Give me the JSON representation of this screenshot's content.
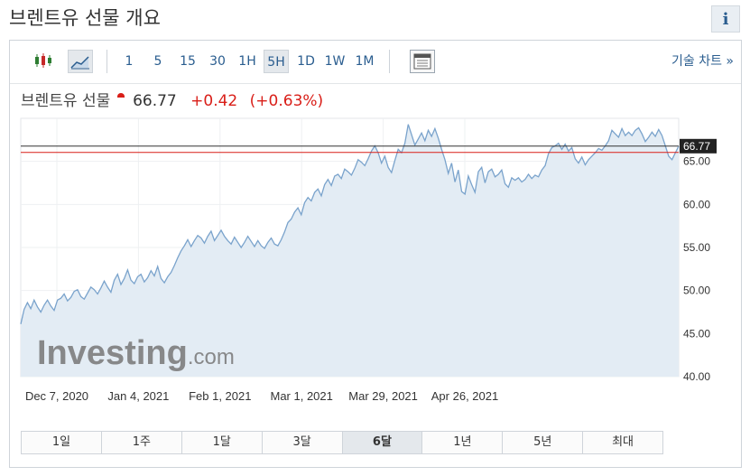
{
  "page": {
    "title": "브렌트유 선물 개요",
    "info_icon": "i"
  },
  "toolbar": {
    "chart_types": [
      {
        "name": "candlestick-chart-icon",
        "selected": false
      },
      {
        "name": "area-chart-icon",
        "selected": true
      }
    ],
    "intervals": [
      {
        "label": "1",
        "selected": false
      },
      {
        "label": "5",
        "selected": false
      },
      {
        "label": "15",
        "selected": false
      },
      {
        "label": "30",
        "selected": false
      },
      {
        "label": "1H",
        "selected": false
      },
      {
        "label": "5H",
        "selected": true
      },
      {
        "label": "1D",
        "selected": false
      },
      {
        "label": "1W",
        "selected": false
      },
      {
        "label": "1M",
        "selected": false
      }
    ],
    "table_icon": "table-view-icon",
    "tech_chart_link": "기술 차트 »"
  },
  "quote": {
    "name": "브렌트유 선물",
    "price": "66.77",
    "change": "+0.42",
    "change_pct": "(+0.63%)",
    "change_color": "#d91e18"
  },
  "chart_data": {
    "type": "area",
    "title": "",
    "xlabel": "",
    "ylabel": "",
    "ylim": [
      40,
      70
    ],
    "yticks": [
      "40.00",
      "45.00",
      "50.00",
      "55.00",
      "60.00",
      "65.00"
    ],
    "x_tick_labels": [
      "Dec 7, 2020",
      "Jan 4, 2021",
      "Feb 1, 2021",
      "Mar 1, 2021",
      "Mar 29, 2021",
      "Apr 26, 2021"
    ],
    "current_label": "66.77",
    "current_value": 66.77,
    "reference_value": 66.35,
    "line_color": "#7aa3cc",
    "fill_color": "#e3ecf4",
    "watermark": "Investing.com",
    "series": [
      {
        "values": [
          46.1,
          47.8,
          48.6,
          47.9,
          48.9,
          48.1,
          47.5,
          48.3,
          48.9,
          48.2,
          47.7,
          48.9,
          49.1,
          49.6,
          48.8,
          49.2,
          49.9,
          50.1,
          49.3,
          49.0,
          49.7,
          50.4,
          50.1,
          49.6,
          50.3,
          51.1,
          50.4,
          49.8,
          51.2,
          51.9,
          50.7,
          51.4,
          52.4,
          51.2,
          50.8,
          51.6,
          51.9,
          51.0,
          51.5,
          52.3,
          51.7,
          52.8,
          51.4,
          50.9,
          51.6,
          52.1,
          52.9,
          53.8,
          54.6,
          55.2,
          55.9,
          55.1,
          55.8,
          56.4,
          56.1,
          55.5,
          56.3,
          56.9,
          55.8,
          56.4,
          57.0,
          56.3,
          55.8,
          55.4,
          56.2,
          55.6,
          55.0,
          55.6,
          56.3,
          55.7,
          55.1,
          55.8,
          55.2,
          54.9,
          55.6,
          56.1,
          55.4,
          55.2,
          55.9,
          56.8,
          57.9,
          58.3,
          59.1,
          59.6,
          58.8,
          60.2,
          60.8,
          60.4,
          61.4,
          61.8,
          61.0,
          62.3,
          62.9,
          62.2,
          63.3,
          63.5,
          63.0,
          64.1,
          63.8,
          63.4,
          64.2,
          65.2,
          64.9,
          64.5,
          65.3,
          66.2,
          66.8,
          66.0,
          64.8,
          65.6,
          64.3,
          63.7,
          65.1,
          66.4,
          66.0,
          67.1,
          69.3,
          68.1,
          66.9,
          67.6,
          68.3,
          67.4,
          68.6,
          67.9,
          68.8,
          67.7,
          66.4,
          65.2,
          63.6,
          64.8,
          62.6,
          64.0,
          61.5,
          61.2,
          63.3,
          62.3,
          61.4,
          63.8,
          64.3,
          62.5,
          63.8,
          64.1,
          63.2,
          63.5,
          64.0,
          62.4,
          62.0,
          63.1,
          62.8,
          63.1,
          62.6,
          62.9,
          63.5,
          63.0,
          63.4,
          63.2,
          64.0,
          64.5,
          65.9,
          66.6,
          66.8,
          67.1,
          66.4,
          67.0,
          66.2,
          66.6,
          65.3,
          64.8,
          65.5,
          64.6,
          65.2,
          65.6,
          66.0,
          66.5,
          66.3,
          66.8,
          67.4,
          68.6,
          68.2,
          67.8,
          68.8,
          68.0,
          68.4,
          68.0,
          68.6,
          68.9,
          68.2,
          67.3,
          67.8,
          68.4,
          67.9,
          68.7,
          68.0,
          66.8,
          65.6,
          65.2,
          66.0,
          66.77
        ]
      }
    ]
  },
  "range_buttons": [
    {
      "label": "1일",
      "selected": false
    },
    {
      "label": "1주",
      "selected": false
    },
    {
      "label": "1달",
      "selected": false
    },
    {
      "label": "3달",
      "selected": false
    },
    {
      "label": "6달",
      "selected": true
    },
    {
      "label": "1년",
      "selected": false
    },
    {
      "label": "5년",
      "selected": false
    },
    {
      "label": "최대",
      "selected": false
    }
  ]
}
